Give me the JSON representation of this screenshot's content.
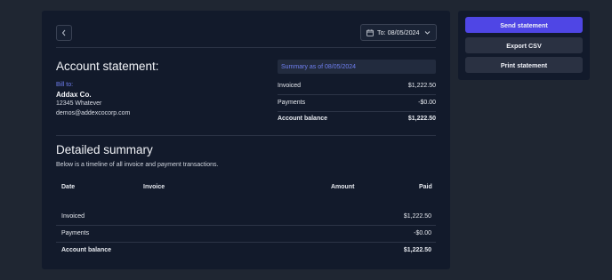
{
  "toolbar": {
    "date_label": "To: 08/05/2024"
  },
  "statement": {
    "title": "Account statement:",
    "bill_to_label": "Bill to:",
    "company": "Addax Co.",
    "address": "12345 Whatever",
    "email": "demos@addexcocorp.com"
  },
  "summary": {
    "as_of": "Summary as of 08/05/2024",
    "rows": [
      {
        "label": "Invoiced",
        "value": "$1,222.50"
      },
      {
        "label": "Payments",
        "value": "-$0.00"
      },
      {
        "label": "Account balance",
        "value": "$1,222.50"
      }
    ]
  },
  "detailed": {
    "title": "Detailed summary",
    "description": "Below is a timeline of all invoice and payment transactions.",
    "headers": {
      "date": "Date",
      "invoice": "Invoice",
      "amount": "Amount",
      "paid": "Paid"
    },
    "rows": [
      {
        "label": "Invoiced",
        "value": "$1,222.50"
      },
      {
        "label": "Payments",
        "value": "-$0.00"
      },
      {
        "label": "Account balance",
        "value": "$1,222.50"
      }
    ]
  },
  "actions": {
    "send": "Send statement",
    "export": "Export CSV",
    "print": "Print statement"
  },
  "colors": {
    "background": "#1f2632",
    "panel": "#121a2b",
    "accent": "#4f46e5",
    "link": "#6f7ff0"
  }
}
